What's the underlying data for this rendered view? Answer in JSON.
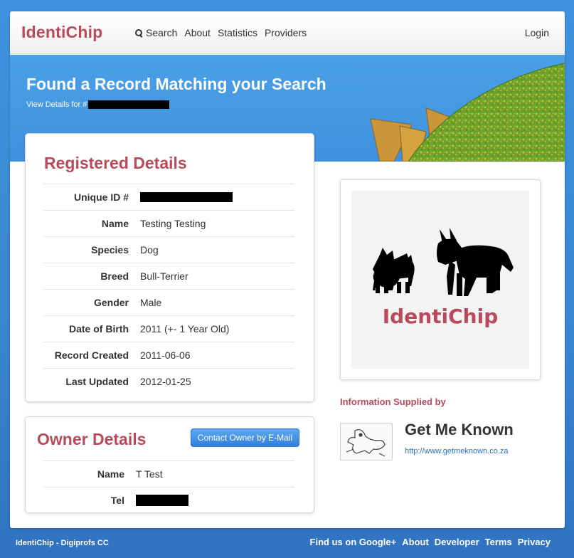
{
  "navbar": {
    "brand": "IdentiChip",
    "items": [
      {
        "label": "Search",
        "icon": "search-icon"
      },
      {
        "label": "About"
      },
      {
        "label": "Statistics"
      },
      {
        "label": "Providers"
      }
    ],
    "login": "Login"
  },
  "hero": {
    "title": "Found a Record Matching your Search",
    "subtitle": "View Details for #"
  },
  "registered": {
    "title": "Registered Details",
    "rows": [
      {
        "label": "Unique ID #",
        "value": ""
      },
      {
        "label": "Name",
        "value": "Testing Testing"
      },
      {
        "label": "Species",
        "value": "Dog"
      },
      {
        "label": "Breed",
        "value": "Bull-Terrier"
      },
      {
        "label": "Gender",
        "value": "Male"
      },
      {
        "label": "Date of Birth",
        "value": "2011 (+- 1 Year Old)"
      },
      {
        "label": "Record Created",
        "value": "2011-06-06"
      },
      {
        "label": "Last Updated",
        "value": "2012-01-25"
      }
    ]
  },
  "owner": {
    "title": "Owner Details",
    "contact_button": "Contact Owner by E-Mail",
    "rows": [
      {
        "label": "Name",
        "value": "T Test"
      },
      {
        "label": "Tel",
        "value": ""
      }
    ]
  },
  "logo_card": {
    "text": "IdentiChip"
  },
  "provider": {
    "label": "Information Supplied by",
    "name": "Get Me Known",
    "url": "http://www.getmeknown.co.za"
  },
  "footer": {
    "left": "IdentiChip - Digiprofs CC",
    "links": [
      "Find us on Google+",
      "About",
      "Developer",
      "Terms",
      "Privacy"
    ]
  },
  "colors": {
    "brand": "#b94a5b",
    "background_blue": "#3f93de",
    "button_blue": "#3a8ae6"
  }
}
